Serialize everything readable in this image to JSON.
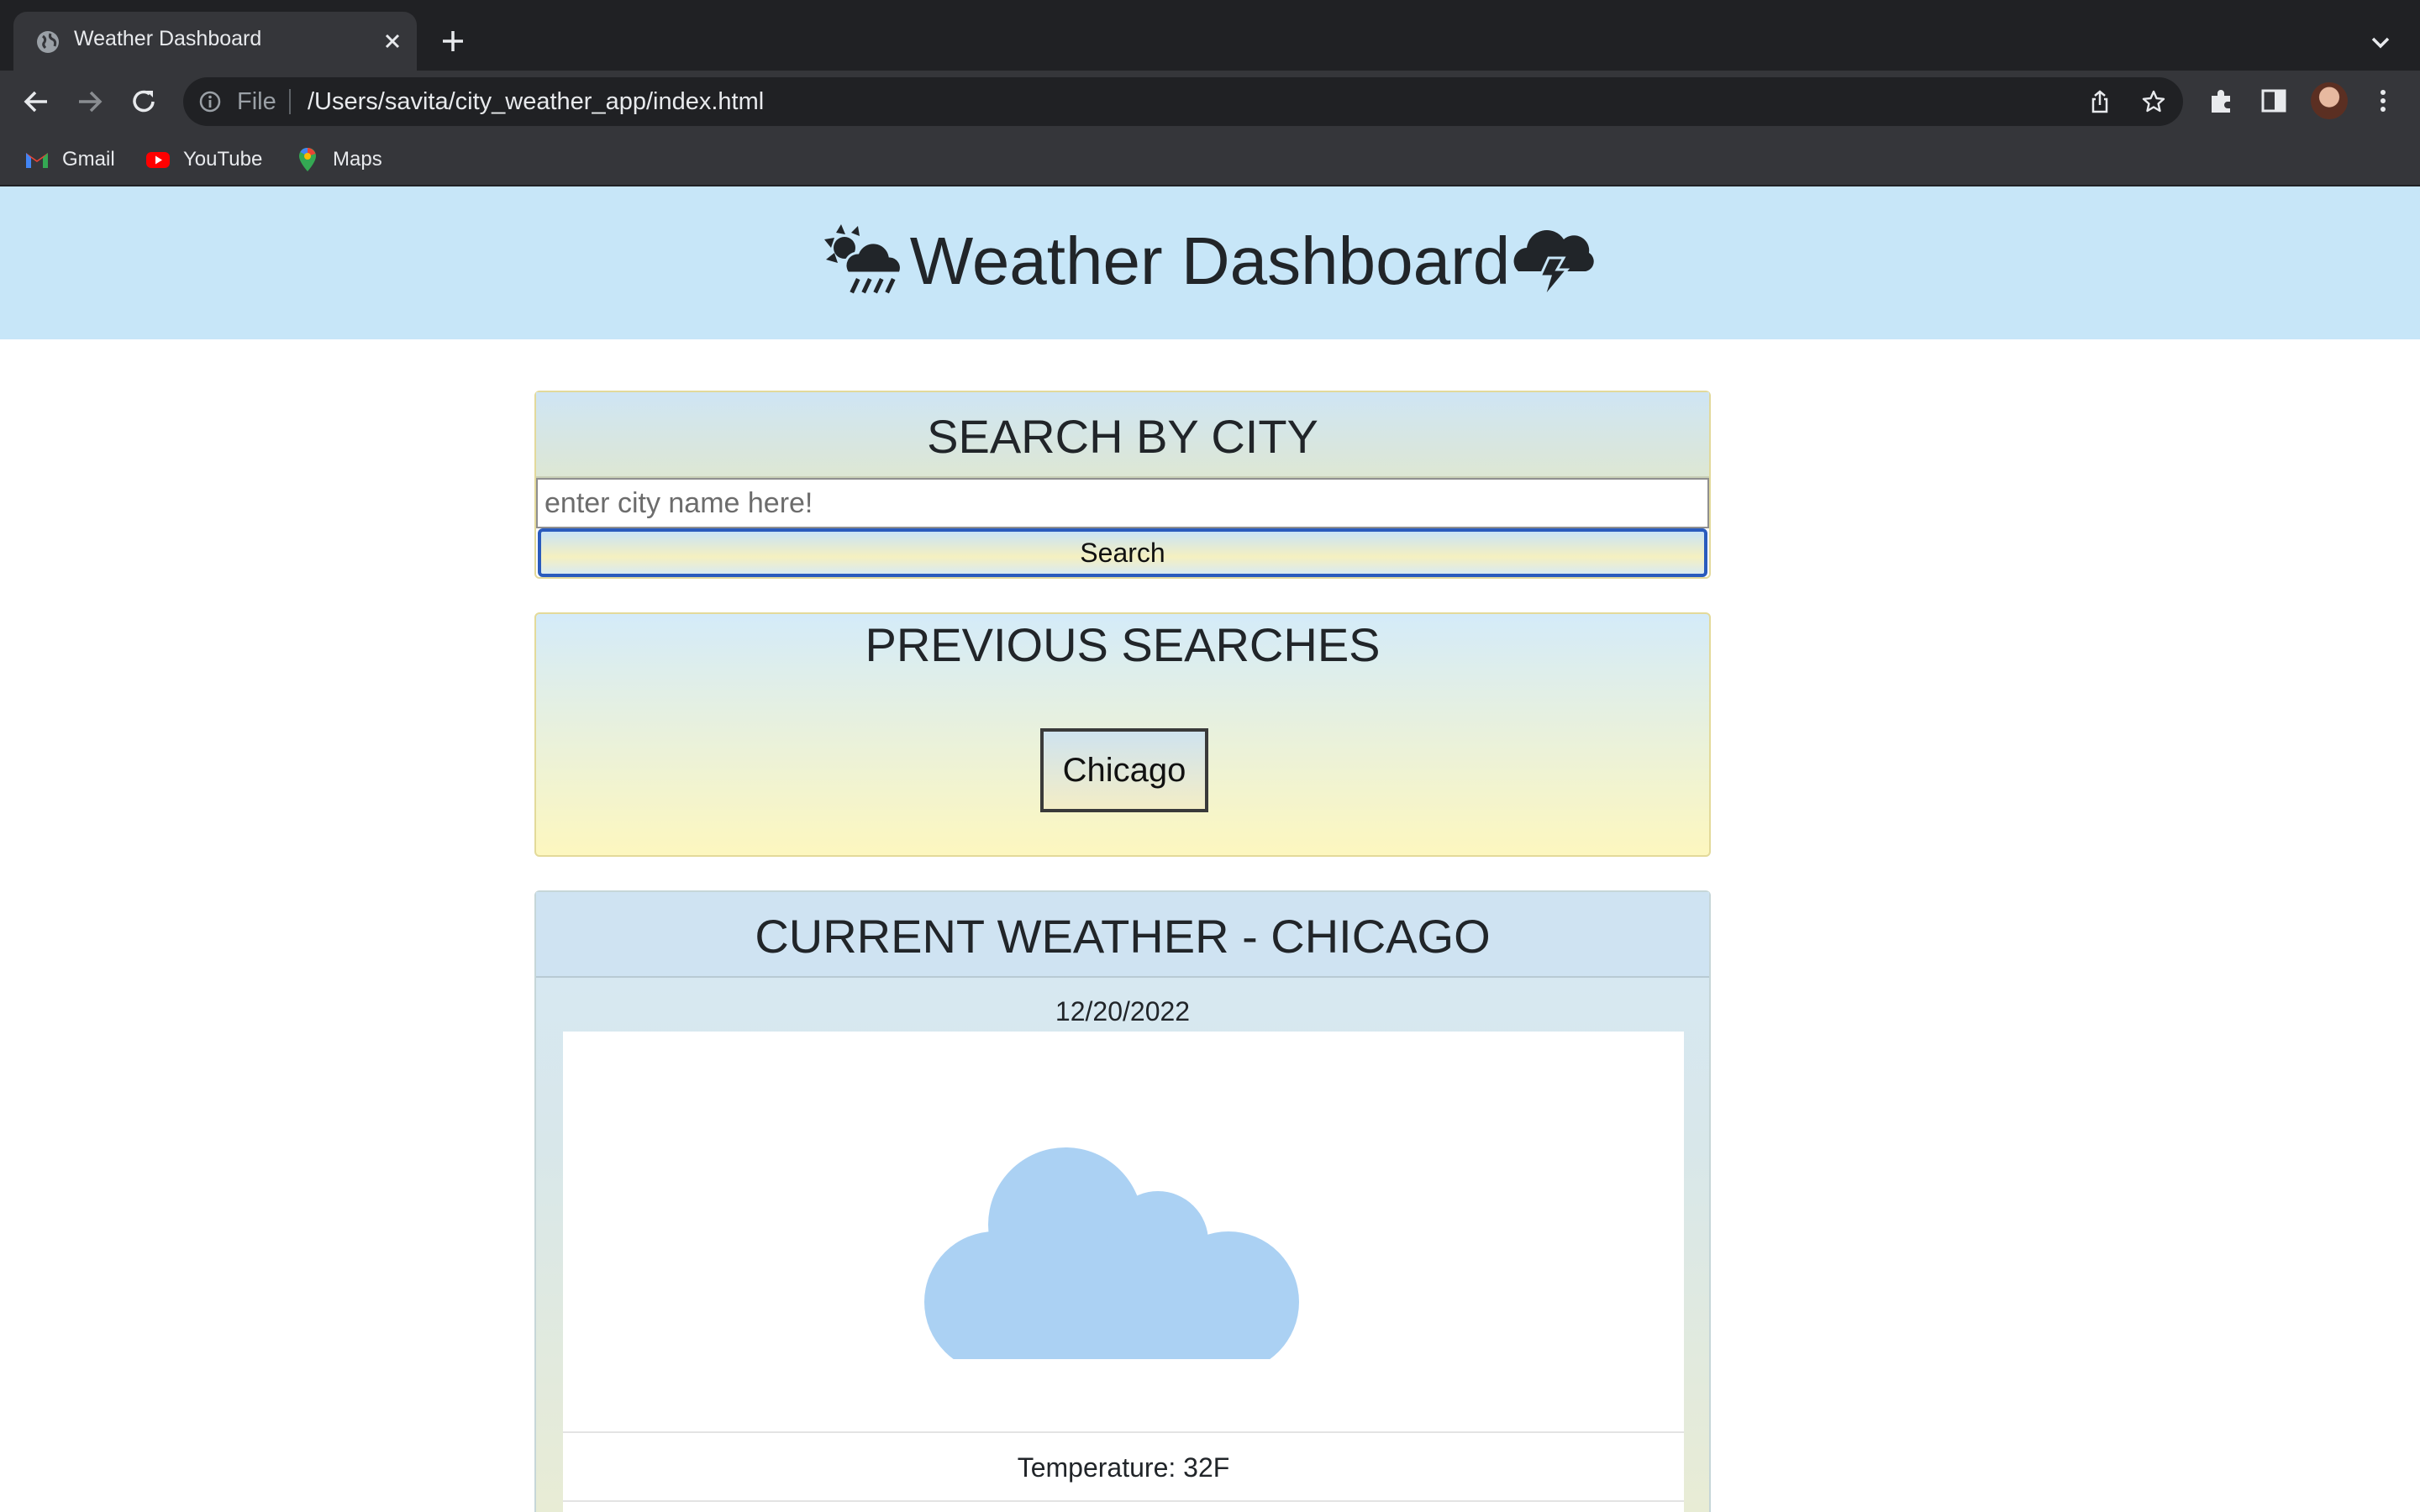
{
  "browser": {
    "tab_title": "Weather Dashboard",
    "scheme_label": "File",
    "url": "/Users/savita/city_weather_app/index.html",
    "bookmarks": [
      {
        "label": "Gmail",
        "icon": "gmail-icon"
      },
      {
        "label": "YouTube",
        "icon": "youtube-icon"
      },
      {
        "label": "Maps",
        "icon": "maps-icon"
      }
    ]
  },
  "header": {
    "title": "Weather Dashboard",
    "left_icon": "sun-cloud-rain-icon",
    "right_icon": "storm-cloud-icon"
  },
  "search": {
    "title": "SEARCH BY CITY",
    "input_placeholder": "enter city name here!",
    "button_label": "Search"
  },
  "history": {
    "title": "PREVIOUS SEARCHES",
    "items": [
      "Chicago"
    ]
  },
  "current": {
    "title": "CURRENT WEATHER - CHICAGO",
    "date": "12/20/2022",
    "condition_icon": "cloud-icon",
    "temperature": "Temperature: 32F"
  },
  "colors": {
    "header_bg": "#c7e6f8",
    "cloud": "#abd1f3",
    "chrome_dark": "#202124",
    "chrome_toolbar": "#35363a",
    "accent_button_border": "#2a5bbd"
  }
}
